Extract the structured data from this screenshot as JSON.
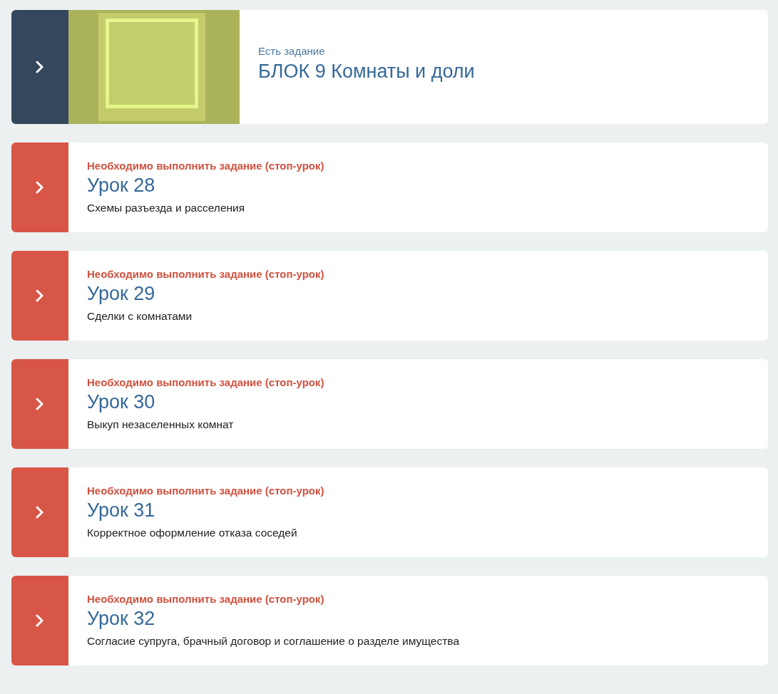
{
  "items": [
    {
      "kind": "block",
      "label": "Есть задание",
      "title": "БЛОК 9 Комнаты и доли"
    },
    {
      "kind": "lesson",
      "status": "Необходимо выполнить задание (стоп-урок)",
      "title": "Урок 28",
      "description": "Схемы разъезда и расселения"
    },
    {
      "kind": "lesson",
      "status": "Необходимо выполнить задание (стоп-урок)",
      "title": "Урок 29",
      "description": "Сделки с комнатами"
    },
    {
      "kind": "lesson",
      "status": "Необходимо выполнить задание (стоп-урок)",
      "title": "Урок 30",
      "description": "Выкуп незаселенных комнат"
    },
    {
      "kind": "lesson",
      "status": "Необходимо выполнить задание (стоп-урок)",
      "title": "Урок 31",
      "description": "Корректное оформление отказа соседей"
    },
    {
      "kind": "lesson",
      "status": "Необходимо выполнить задание (стоп-урок)",
      "title": "Урок 32",
      "description": "Согласие супруга, брачный договор и соглашение о разделе имущества"
    }
  ]
}
